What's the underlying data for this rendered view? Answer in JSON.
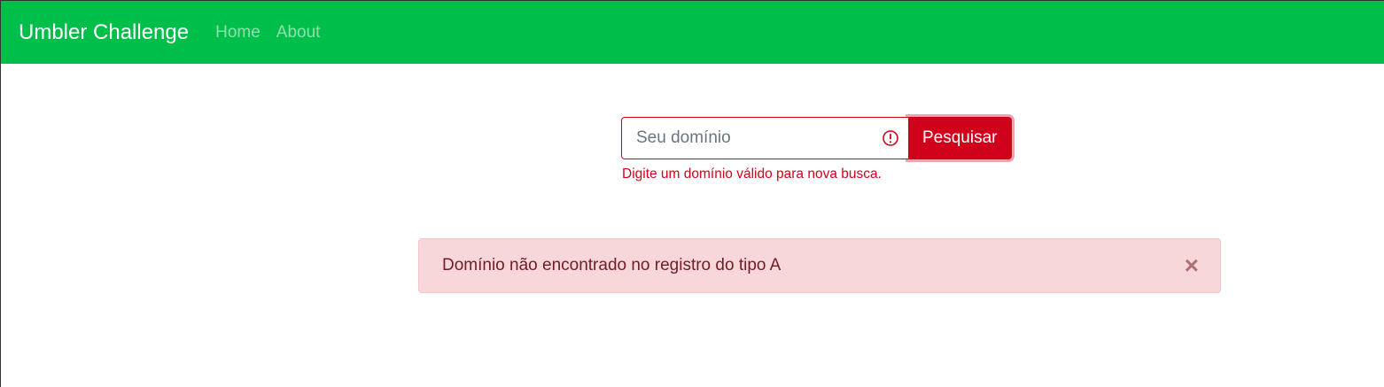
{
  "navbar": {
    "brand": "Umbler Challenge",
    "links": [
      "Home",
      "About"
    ],
    "background_color": "#00be4a"
  },
  "search": {
    "placeholder": "Seu domínio",
    "value": "",
    "button_label": "Pesquisar",
    "invalid": true,
    "validation_message": "Digite um domínio válido para nova busca.",
    "accent_color": "#d0021b"
  },
  "alert": {
    "message": "Domínio não encontrado no registro do tipo A",
    "close_symbol": "×",
    "background_color": "#f8d7da",
    "text_color": "#721c24"
  },
  "icons": {
    "input_status": "exclamation-circle-icon",
    "alert_close": "close-icon"
  }
}
